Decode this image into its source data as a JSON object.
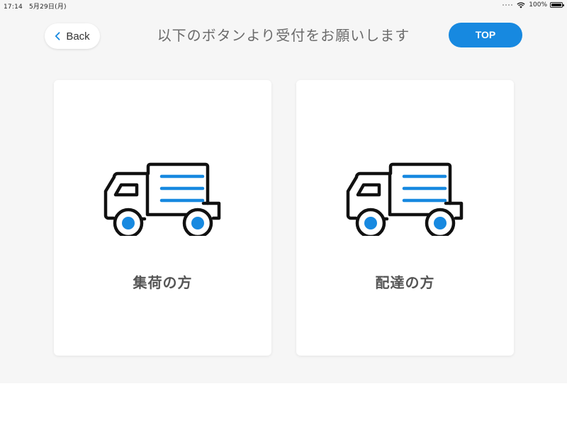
{
  "status_bar": {
    "time": "17:14",
    "date": "5月29日(月)",
    "battery": "100%"
  },
  "header": {
    "back_label": "Back",
    "title": "以下のボタンより受付をお願いします",
    "top_label": "TOP"
  },
  "cards": [
    {
      "label": "集荷の方",
      "icon": "truck-icon"
    },
    {
      "label": "配達の方",
      "icon": "truck-icon"
    }
  ],
  "colors": {
    "accent": "#1789e0",
    "background": "#f6f6f6",
    "card": "#ffffff",
    "text": "#555555"
  }
}
